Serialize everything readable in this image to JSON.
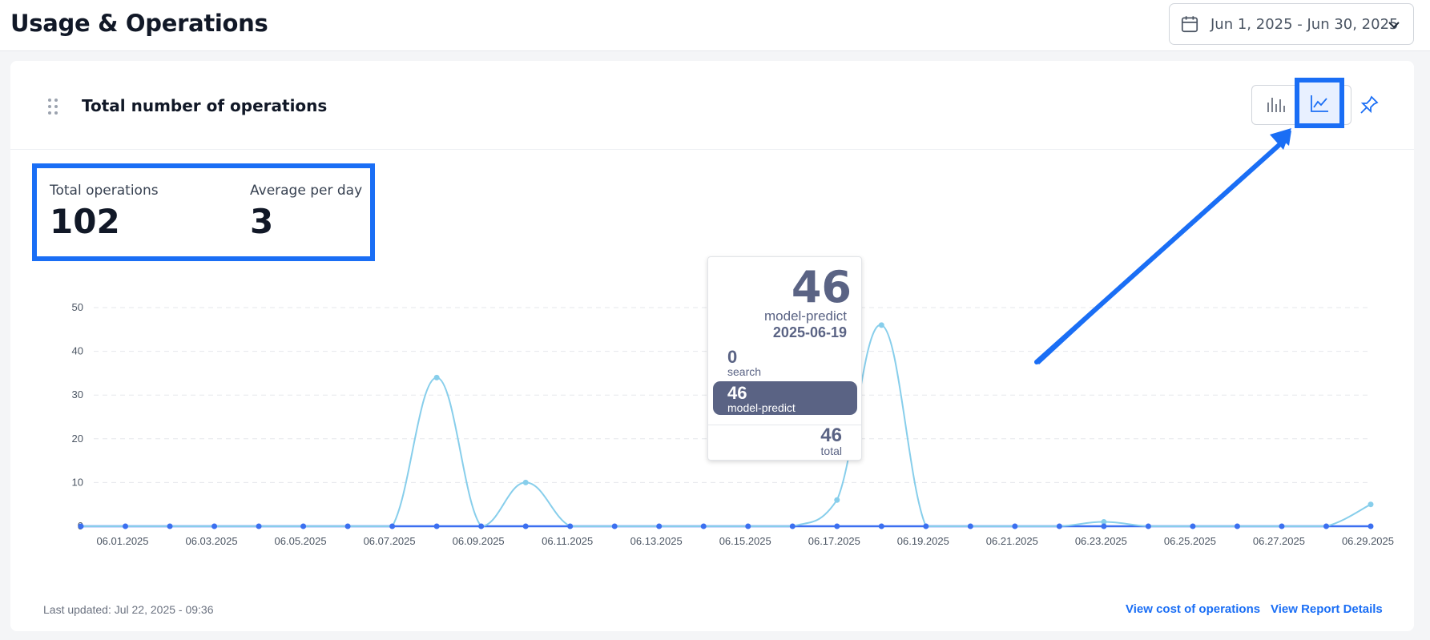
{
  "page": {
    "title": "Usage & Operations"
  },
  "date_range": {
    "value": "Jun 1, 2025 - Jun 30, 2025",
    "icon": "calendar-icon"
  },
  "card": {
    "title": "Total number of operations",
    "toggle": {
      "bar_icon": "bar-chart-icon",
      "line_icon": "line-chart-icon",
      "selected": "line"
    },
    "pin_icon": "pin-icon"
  },
  "stats": {
    "total_label": "Total operations",
    "total_value": "102",
    "avg_label": "Average per day",
    "avg_value": "3"
  },
  "tooltip": {
    "big_value": "46",
    "series": "model-predict",
    "date": "2025-06-19",
    "rows": [
      {
        "value": "0",
        "label": "search",
        "active": false
      },
      {
        "value": "46",
        "label": "model-predict",
        "active": true
      }
    ],
    "total_value": "46",
    "total_label": "total"
  },
  "footer": {
    "last_updated": "Last updated: Jul 22, 2025 - 09:36",
    "link_cost": "View cost of operations",
    "link_report": "View Report Details"
  },
  "colors": {
    "accent": "#1a6ef5",
    "model_predict": "#87ceeb",
    "search": "#3b6ff0",
    "tooltip": "#5a6384"
  },
  "chart_data": {
    "type": "line",
    "x_tick_labels": [
      "06.01.2025",
      "06.03.2025",
      "06.05.2025",
      "06.07.2025",
      "06.09.2025",
      "06.11.2025",
      "06.13.2025",
      "06.15.2025",
      "06.17.2025",
      "06.19.2025",
      "06.21.2025",
      "06.23.2025",
      "06.25.2025",
      "06.27.2025",
      "06.29.2025"
    ],
    "y_tick_labels": [
      "0",
      "10",
      "20",
      "30",
      "40",
      "50"
    ],
    "ylim": [
      0,
      50
    ],
    "grid": true,
    "series": [
      {
        "name": "model-predict",
        "color": "#87ceeb",
        "values": [
          0,
          0,
          0,
          0,
          0,
          0,
          0,
          0,
          34,
          0,
          10,
          0,
          0,
          0,
          0,
          0,
          0,
          6,
          46,
          0,
          0,
          0,
          0,
          1,
          0,
          0,
          0,
          0,
          0,
          5
        ]
      },
      {
        "name": "search",
        "color": "#3b6ff0",
        "values": [
          0,
          0,
          0,
          0,
          0,
          0,
          0,
          0,
          0,
          0,
          0,
          0,
          0,
          0,
          0,
          0,
          0,
          0,
          0,
          0,
          0,
          0,
          0,
          0,
          0,
          0,
          0,
          0,
          0,
          0
        ]
      }
    ]
  }
}
